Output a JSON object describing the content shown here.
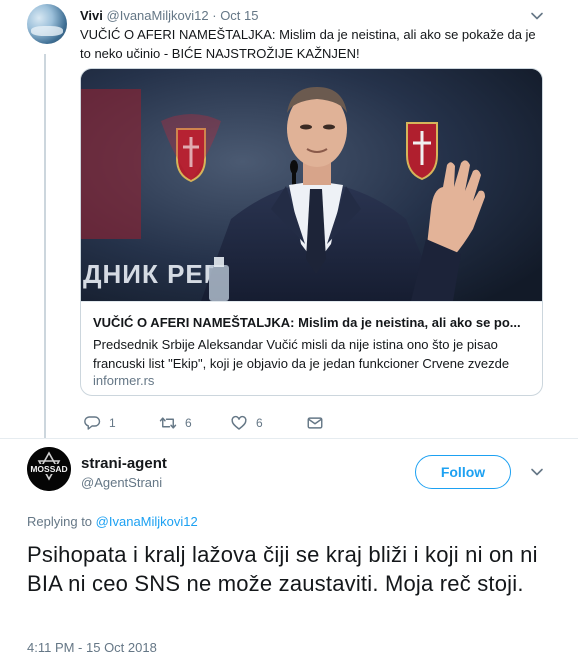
{
  "parent_tweet": {
    "name": "Vivi",
    "handle": "@IvanaMiljkovi12",
    "separator": "·",
    "time": "Oct 15",
    "text": "VUČIĆ O AFERI NAMEŠTALJKA: Mislim da je neistina, ali ako se pokaže da je to neko učinio - BIĆE NAJSTROŽIJE KAŽNJEN!",
    "card": {
      "image_sign_text": "ДНИК РЕП",
      "title": "VUČIĆ O AFERI NAMEŠTALJKA: Mislim da je neistina, ali ako se po...",
      "description": "Predsednik Srbije Aleksandar Vučić misli da nije istina ono što je pisao francuski list \"Ekip\", koji je objavio da je jedan funkcioner Crvene zvezde",
      "domain": "informer.rs"
    },
    "actions": {
      "reply_count": "1",
      "retweet_count": "6",
      "like_count": "6"
    }
  },
  "main_tweet": {
    "avatar_text": "MOSSAD",
    "name": "strani-agent",
    "handle": "@AgentStrani",
    "follow_label": "Follow",
    "replying_prefix": "Replying to",
    "replying_to": "@IvanaMiljkovi12",
    "text": "Psihopata i kralj lažova čiji se kraj bliži i koji ni on ni BIA ni ceo SNS ne može zaustaviti. Moja reč stoji.",
    "timestamp": "4:11 PM - 15 Oct 2018"
  },
  "colors": {
    "accent": "#1da1f2",
    "secondary_text": "#657786",
    "border": "#ccd6dd"
  }
}
